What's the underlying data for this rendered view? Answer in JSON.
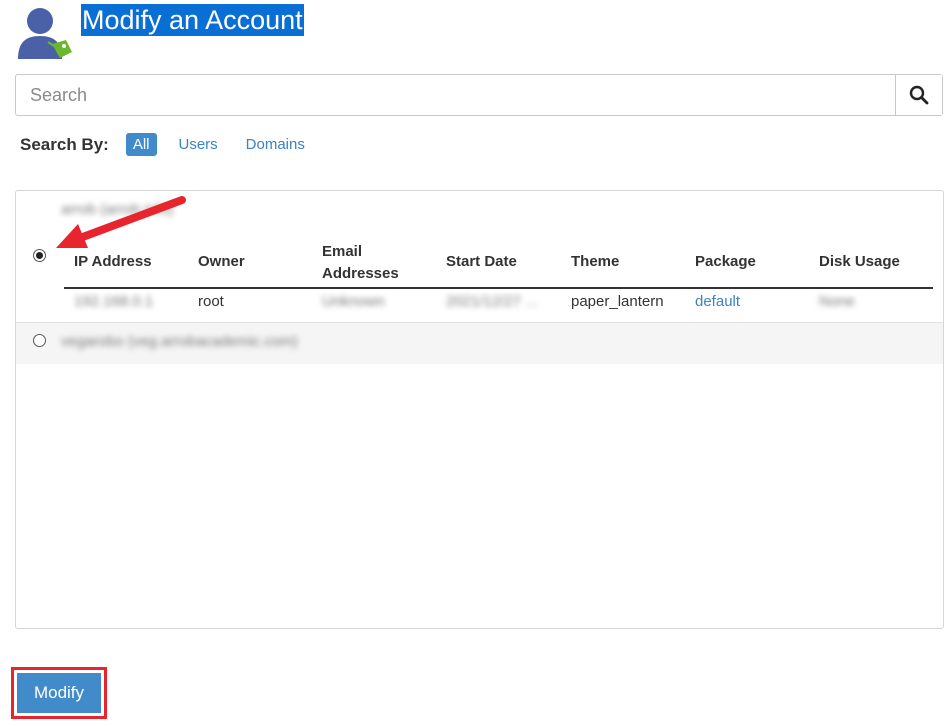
{
  "header": {
    "title": "Modify an Account",
    "icon": "user-tag-icon"
  },
  "search": {
    "placeholder": "Search",
    "value": "",
    "button_icon": "search-icon"
  },
  "search_by": {
    "label": "Search By:",
    "options": [
      "All",
      "Users",
      "Domains"
    ],
    "selected": "All"
  },
  "accounts": [
    {
      "name": "arrob (arrob.info)",
      "selected": true,
      "details": {
        "columns": [
          "IP Address",
          "Owner",
          "Email Addresses",
          "Start Date",
          "Theme",
          "Package",
          "Disk Usage"
        ],
        "ip_address": "192.168.0.1",
        "owner": "root",
        "email_addresses": "Unknown",
        "start_date": "2021/12/27 ...",
        "theme": "paper_lantern",
        "package": "default",
        "disk_usage": "None"
      }
    },
    {
      "name": "vegarobo (veg.arrobacademic.com)",
      "selected": false
    }
  ],
  "footer": {
    "modify_label": "Modify"
  },
  "colors": {
    "primary": "#428bca",
    "title_highlight": "#0a6fd4",
    "annotation": "#e8242f",
    "link": "#3a83c4"
  }
}
